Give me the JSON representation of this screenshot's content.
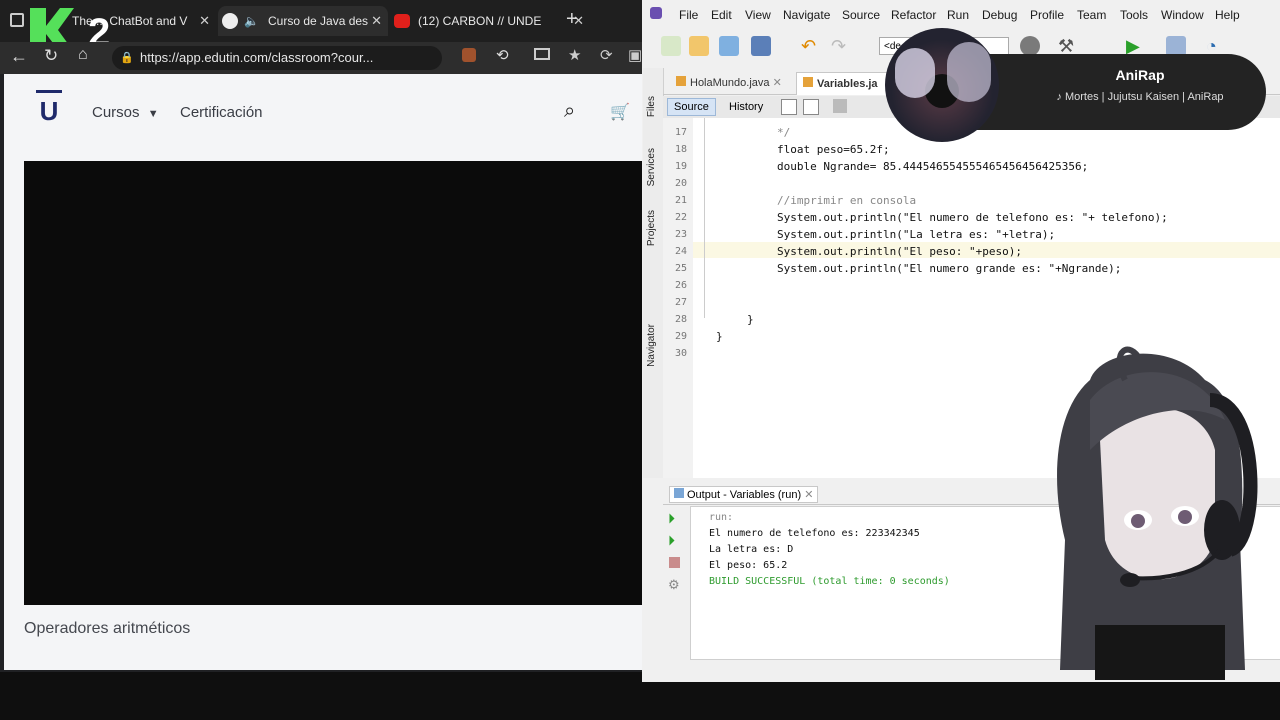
{
  "browser": {
    "tabs": [
      {
        "label": "The ... ChatBot and V",
        "active": false
      },
      {
        "label": "Curso de Java des",
        "active": true
      },
      {
        "label": "(12) CARBON // UNDE",
        "active": false
      }
    ],
    "url": "https://app.edutin.com/classroom?cour...",
    "site": {
      "logo_letter": "U",
      "nav": [
        "Cursos",
        "Certificación"
      ],
      "lesson_title": "Operadores aritméticos"
    }
  },
  "watermark": {
    "text": "2"
  },
  "ide": {
    "menu": [
      "File",
      "Edit",
      "View",
      "Navigate",
      "Source",
      "Refactor",
      "Run",
      "Debug",
      "Profile",
      "Team",
      "Tools",
      "Window",
      "Help"
    ],
    "toolbar_select": "<de",
    "side_labels": [
      "Files",
      "Services",
      "Projects",
      "Navigator"
    ],
    "editor_tabs": [
      {
        "label": "HolaMundo.java",
        "active": false
      },
      {
        "label": "Variables.ja",
        "active": true
      }
    ],
    "source_tabs": [
      "Source",
      "History"
    ],
    "code_lines": [
      {
        "n": "17",
        "text": "*/"
      },
      {
        "n": "18",
        "text": "float peso=65.2f;"
      },
      {
        "n": "19",
        "text": "double Ngrande= 85.444546554555465456456425356;"
      },
      {
        "n": "20",
        "text": ""
      },
      {
        "n": "21",
        "text": "//imprimir en consola"
      },
      {
        "n": "22",
        "text": "System.out.println(\"El numero de telefono es: \"+ telefono);"
      },
      {
        "n": "23",
        "text": "System.out.println(\"La letra es: \"+letra);"
      },
      {
        "n": "24",
        "text": "System.out.println(\"El peso: \"+peso);"
      },
      {
        "n": "25",
        "text": "System.out.println(\"El numero grande es: \"+Ngrande);"
      },
      {
        "n": "26",
        "text": ""
      },
      {
        "n": "27",
        "text": ""
      },
      {
        "n": "28",
        "text": "}"
      },
      {
        "n": "29",
        "text": "}"
      },
      {
        "n": "30",
        "text": ""
      }
    ],
    "output": {
      "title": "Output - Variables (run)",
      "lines": [
        "run:",
        "El numero de telefono es: 223342345",
        "La letra es: D",
        "El peso: 65.2",
        "BUILD SUCCESSFUL (total time: 0 seconds)"
      ]
    }
  },
  "now_playing": {
    "title": "AniRap",
    "subtitle": "♪ Mortes | Jujutsu Kaisen | AniRap"
  },
  "colors": {
    "accent_blue": "#1f2a6b",
    "kw": "#0033cc",
    "string": "#d08000",
    "green": "#009900"
  }
}
